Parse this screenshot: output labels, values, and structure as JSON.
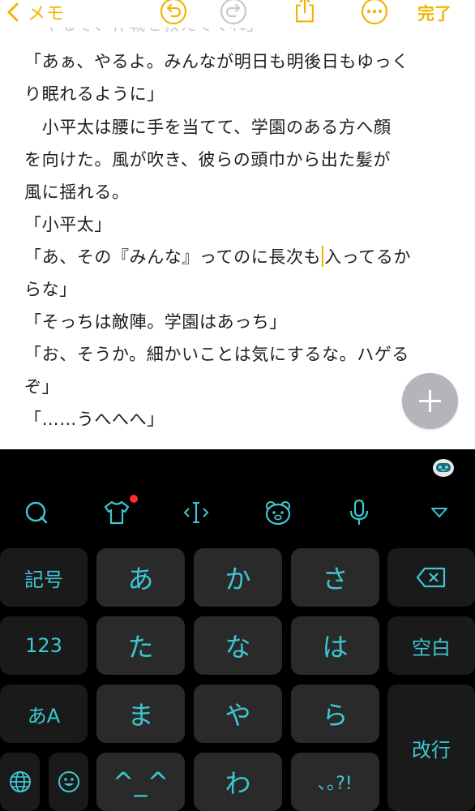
{
  "nav": {
    "back_label": "メモ",
    "done_label": "完了",
    "accent": "#f1b500",
    "icons": [
      "chevron-left-icon",
      "undo-icon",
      "redo-icon",
      "share-icon",
      "more-icon"
    ]
  },
  "note": {
    "partial_top_line": "「やるぞ、作戦を教えてくれ」",
    "lines": [
      "「あぁ、やるよ。みんなが明日も明後日もゆっく",
      "り眠れるように」",
      "　小平太は腰に手を当てて、学園のある方へ顔",
      "を向けた。風が吹き、彼らの頭巾から出た髪が",
      "風に揺れる。",
      "「小平太」",
      "「あ、その『みんな』ってのに長次も",
      "らな」",
      "「そっちは敵陣。学園はあっち」",
      "「お、そうか。細かいことは気にするな。ハゲる",
      "ぞ」",
      "「……うへへへ」"
    ],
    "caret_line_after": "入ってるか",
    "add_button_icon": "plus-icon"
  },
  "keyboard": {
    "theme_color": "#3cc8d2",
    "toolbar_icons": [
      "mascot-icon",
      "search-icon",
      "tshirt-icon",
      "cursor-move-icon",
      "bear-face-icon",
      "microphone-icon",
      "collapse-keyboard-icon"
    ],
    "keys": {
      "symbols": "記号",
      "numbers": "123",
      "kana_alpha": "あA",
      "a": "あ",
      "ka": "か",
      "sa": "さ",
      "ta": "た",
      "na": "な",
      "ha": "は",
      "ma": "ま",
      "ya": "や",
      "ra": "ら",
      "emoticon": "^_^",
      "wa": "わ",
      "punct": "､｡?!",
      "space": "空白",
      "enter": "改行"
    }
  }
}
